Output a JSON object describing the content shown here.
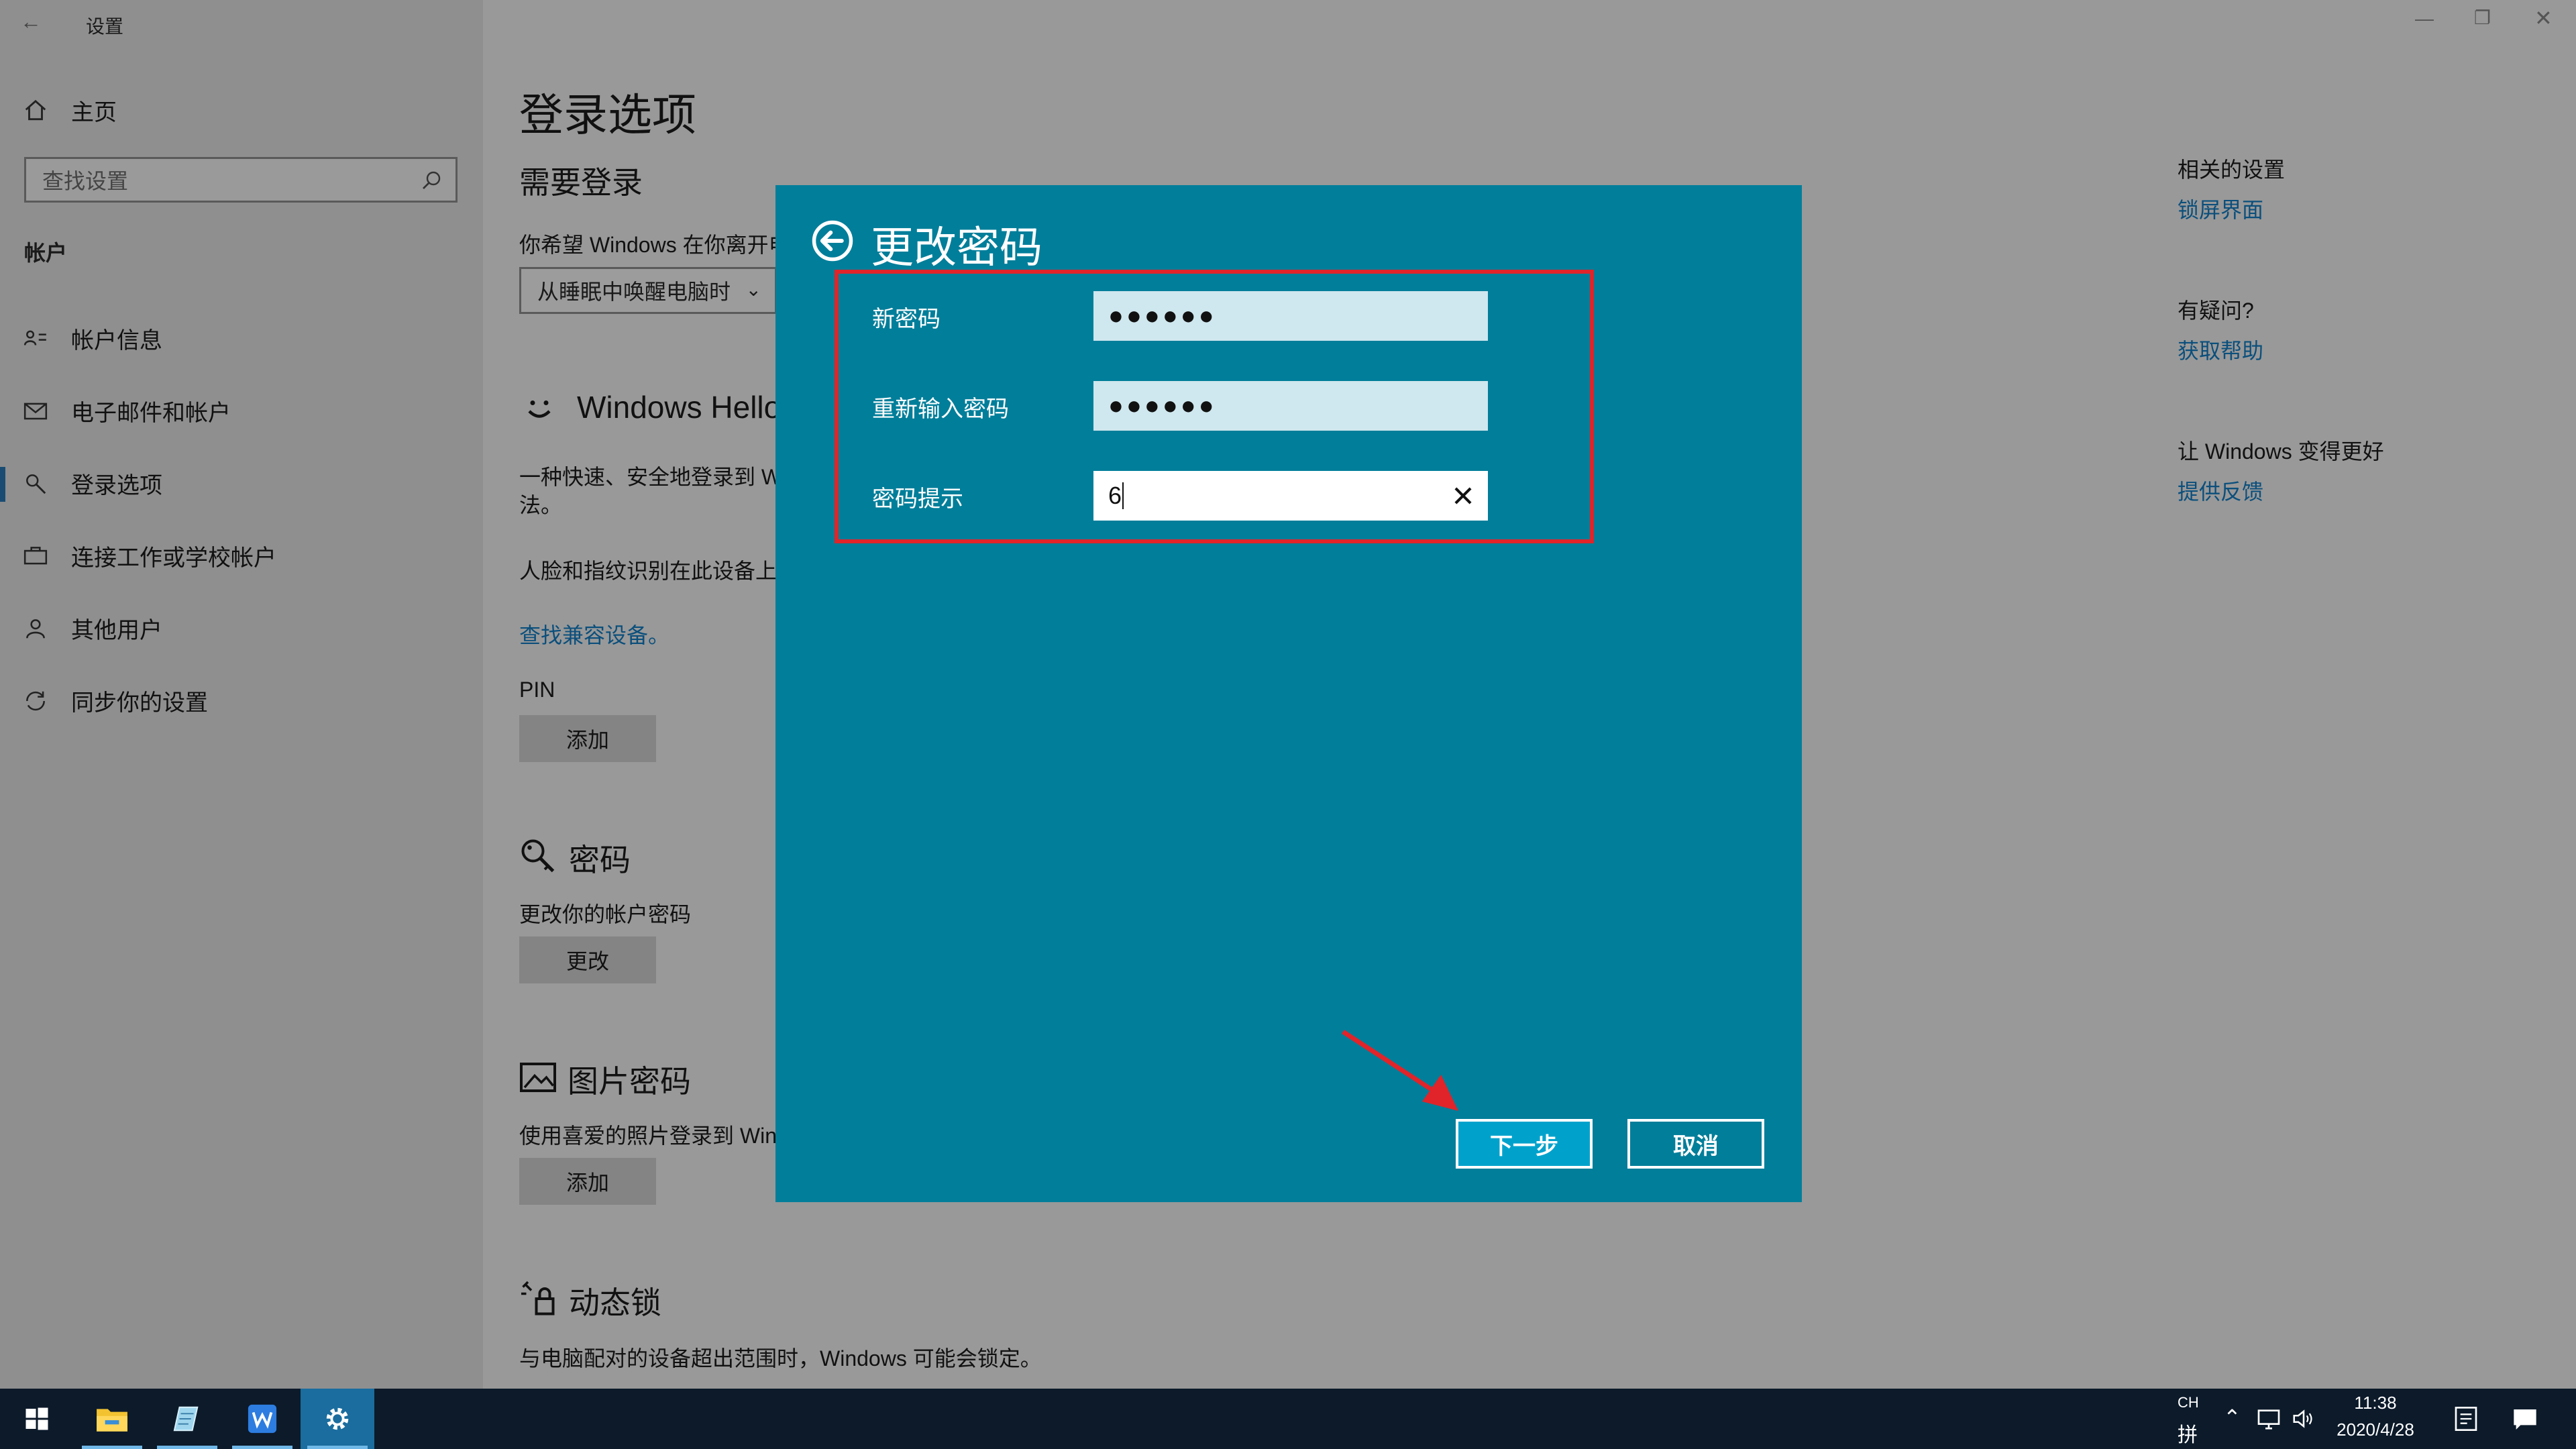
{
  "window": {
    "title": "设置"
  },
  "sidebar": {
    "home_label": "主页",
    "search_placeholder": "查找设置",
    "section_label": "帐户",
    "items": [
      {
        "label": "帐户信息",
        "icon": "account-info-icon"
      },
      {
        "label": "电子邮件和帐户",
        "icon": "mail-icon"
      },
      {
        "label": "登录选项",
        "icon": "key-icon",
        "selected": true
      },
      {
        "label": "连接工作或学校帐户",
        "icon": "briefcase-icon"
      },
      {
        "label": "其他用户",
        "icon": "person-icon"
      },
      {
        "label": "同步你的设置",
        "icon": "sync-icon"
      }
    ]
  },
  "main": {
    "page_title": "登录选项",
    "require_signin": {
      "heading": "需要登录",
      "description": "你希望 Windows 在你离开电",
      "dropdown_value": "从睡眠中唤醒电脑时"
    },
    "hello": {
      "heading": "Windows Hello",
      "description_line1": "一种快速、安全地登录到 W",
      "description_line2": "法。",
      "note": "人脸和指纹识别在此设备上",
      "link": "查找兼容设备。",
      "pin_label": "PIN",
      "pin_button": "添加"
    },
    "password": {
      "heading": "密码",
      "description": "更改你的帐户密码",
      "button": "更改"
    },
    "picture_password": {
      "heading": "图片密码",
      "description": "使用喜爱的照片登录到 Win",
      "button": "添加"
    },
    "dynamic_lock": {
      "heading": "动态锁",
      "description": "与电脑配对的设备超出范围时，Windows 可能会锁定。"
    }
  },
  "right_panel": {
    "related_heading": "相关的设置",
    "related_link": "锁屏界面",
    "question_heading": "有疑问?",
    "question_link": "获取帮助",
    "improve_heading": "让 Windows 变得更好",
    "improve_link": "提供反馈"
  },
  "dialog": {
    "title": "更改密码",
    "fields": {
      "new_password_label": "新密码",
      "new_password_value": "●●●●●●",
      "confirm_password_label": "重新输入密码",
      "confirm_password_value": "●●●●●●",
      "hint_label": "密码提示",
      "hint_value": "6"
    },
    "next_button": "下一步",
    "cancel_button": "取消"
  },
  "taskbar": {
    "apps": [
      "start-icon",
      "file-explorer-icon",
      "notepad-icon",
      "wps-icon",
      "settings-icon"
    ],
    "language": "CH",
    "ime": "拼",
    "time": "11:38",
    "date": "2020/4/28"
  },
  "colors": {
    "dialog_bg": "#007e9a",
    "primary_button": "#00a2cc",
    "highlight_box": "#e0242a",
    "link": "#0b4f7c",
    "taskbar": "#0c1a2a"
  }
}
